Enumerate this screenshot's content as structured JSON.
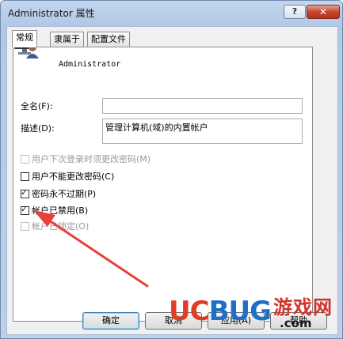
{
  "window": {
    "title": "Administrator 属性",
    "help_label": "?",
    "close_label": "✕"
  },
  "tabs": [
    {
      "label": "常规",
      "active": true
    },
    {
      "label": "隶属于",
      "active": false
    },
    {
      "label": "配置文件",
      "active": false
    }
  ],
  "user": {
    "name": "Administrator",
    "icon": "user-computer-icon"
  },
  "fields": {
    "full_name_label": "全名(F):",
    "full_name_value": "",
    "description_label": "描述(D):",
    "description_value": "管理计算机(域)的内置帐户"
  },
  "checkboxes": [
    {
      "label": "用户下次登录时须更改密码(M)",
      "checked": false,
      "disabled": true
    },
    {
      "label": "用户不能更改密码(C)",
      "checked": false,
      "disabled": false
    },
    {
      "label": "密码永不过期(P)",
      "checked": true,
      "disabled": false
    },
    {
      "label": "帐户已禁用(B)",
      "checked": true,
      "disabled": false
    },
    {
      "label": "帐户已锁定(O)",
      "checked": false,
      "disabled": true
    }
  ],
  "buttons": {
    "ok": "确定",
    "cancel": "取消",
    "apply": "应用(A)",
    "help": "帮助"
  },
  "watermark": {
    "uc": "UC",
    "bug": "BUG",
    "cn": "游戏网",
    "com": ".com"
  },
  "colors": {
    "arrow": "#e8413a",
    "title_bar": "#b9cfe8"
  }
}
